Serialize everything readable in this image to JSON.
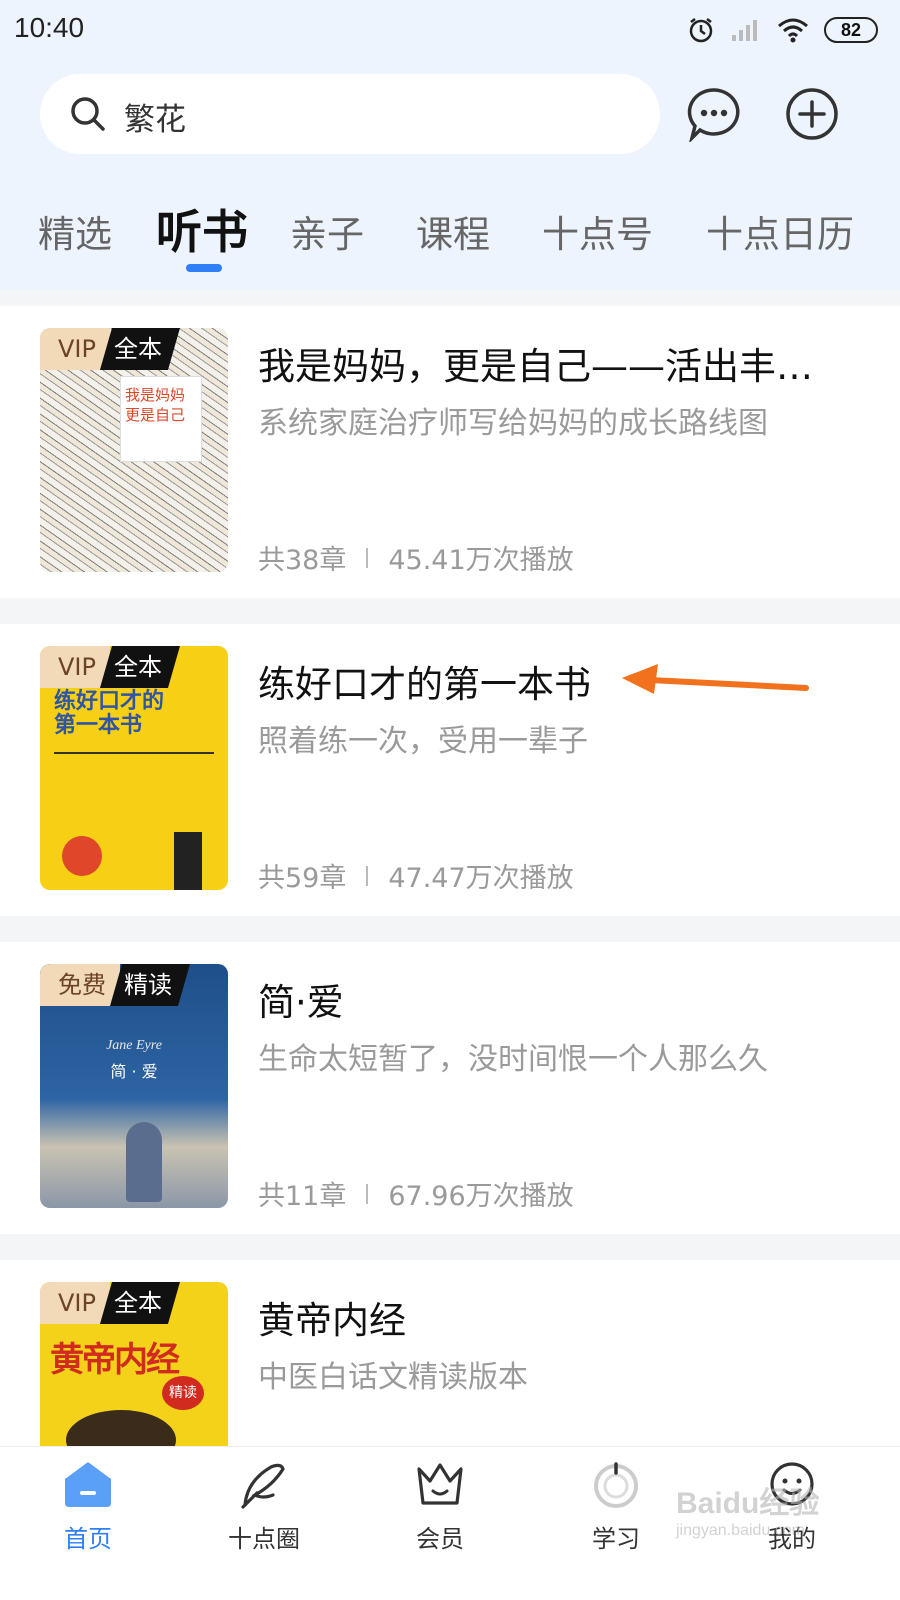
{
  "status_bar": {
    "time": "10:40",
    "battery": "82"
  },
  "search": {
    "text": "繁花"
  },
  "tabs": [
    {
      "label": "精选"
    },
    {
      "label": "听书"
    },
    {
      "label": "亲子"
    },
    {
      "label": "课程"
    },
    {
      "label": "十点号"
    },
    {
      "label": "十点日历"
    }
  ],
  "books": [
    {
      "badge1": "VIP",
      "badge2": "全本",
      "title": "我是妈妈，更是自己——活出丰…",
      "subtitle": "系统家庭治疗师写给妈妈的成长路线图",
      "chapters": "共38章",
      "plays": "45.41万次播放",
      "cover_text": [
        "我是妈妈",
        "更是自己"
      ]
    },
    {
      "badge1": "VIP",
      "badge2": "全本",
      "title": "练好口才的第一本书",
      "subtitle": "照着练一次，受用一辈子",
      "chapters": "共59章",
      "plays": "47.47万次播放",
      "cover_text": [
        "练好口才的",
        "第一本书"
      ]
    },
    {
      "badge1": "免费",
      "badge2": "精读",
      "title": "简·爱",
      "subtitle": "生命太短暂了，没时间恨一个人那么久",
      "chapters": "共11章",
      "plays": "67.96万次播放",
      "cover_text": [
        "Jane Eyre",
        "简 · 爱"
      ]
    },
    {
      "badge1": "VIP",
      "badge2": "全本",
      "title": "黄帝内经",
      "subtitle": "中医白话文精读版本",
      "cover_text": [
        "黄帝内经",
        "精读"
      ]
    }
  ],
  "bottom_nav": [
    {
      "label": "首页"
    },
    {
      "label": "十点圈"
    },
    {
      "label": "会员"
    },
    {
      "label": "学习"
    },
    {
      "label": "我的"
    }
  ],
  "watermark": {
    "main": "Baidu经验",
    "sub": "jingyan.baidu.com"
  },
  "colors": {
    "accent": "#2f7ff7",
    "arrow": "#f2711c",
    "top_bg": "#eef4fd"
  }
}
